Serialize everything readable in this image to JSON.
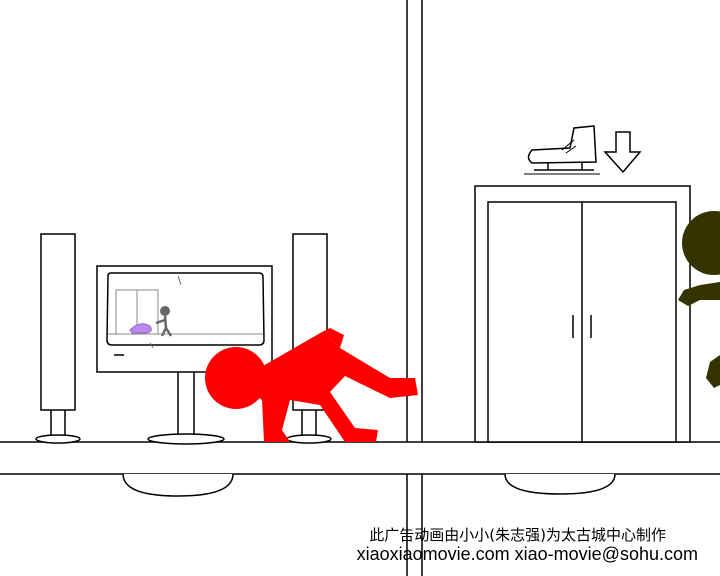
{
  "scene": {
    "description_free": true,
    "colors": {
      "background": "#ffffff",
      "line": "#000000",
      "red_figure": "#ff0000",
      "dark_figure": "#333300",
      "tv_figure": "#666666",
      "tv_cat": "#bb88ee"
    },
    "icons": {
      "skate": "ice-skate-icon",
      "arrow": "down-arrow-icon"
    }
  },
  "captions": {
    "credit": "此广告动画由小小(朱志强)为太古城中心制作",
    "contact": "xiaoxiaomovie.com  xiao-movie@sohu.com"
  }
}
